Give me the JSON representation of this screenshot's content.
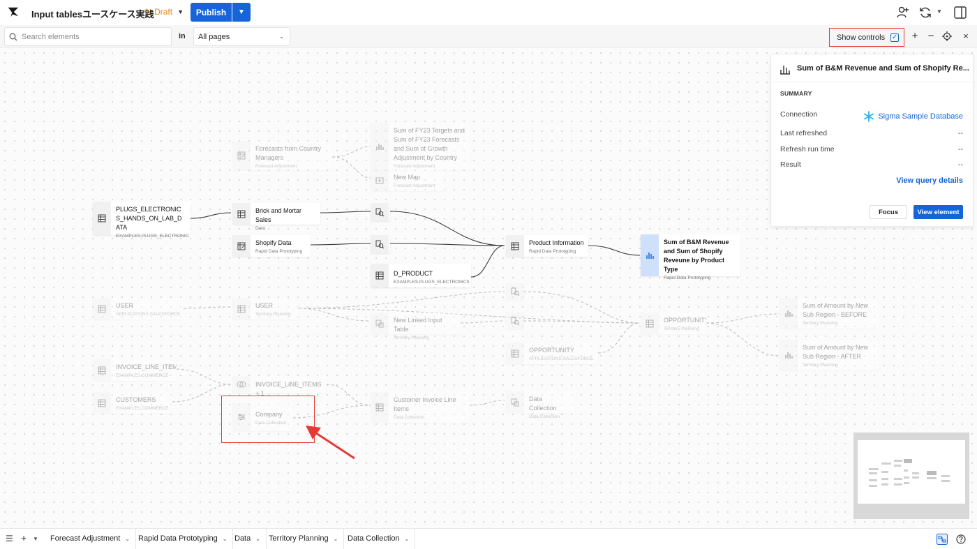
{
  "header": {
    "title": "Input tablesユースケース実践",
    "status": "Draft",
    "publish_label": "Publish"
  },
  "filter_bar": {
    "search_placeholder": "Search elements",
    "in_label": "in",
    "pages_value": "All pages",
    "show_controls_label": "Show controls",
    "show_controls_checked": true
  },
  "nodes": [
    {
      "id": "n1",
      "name": "Forecasts from Country Managers",
      "sub": "Forecast Adjustment",
      "icon": "input-table-icon",
      "faded": true
    },
    {
      "id": "n2",
      "name": "Sum of FY23 Targets and Sum of FY23 Forecasts and Sum of Growth Adjustment by Country",
      "sub": "Forecast Adjustment",
      "icon": "bar-chart-icon",
      "faded": true
    },
    {
      "id": "n3",
      "name": "New Map",
      "sub": "Forecast Adjustment",
      "icon": "map-icon",
      "faded": true
    },
    {
      "id": "n4",
      "name": "PLUGS_ELECTRONICS_HANDS_ON_LAB_DATA",
      "sub": "EXAMPLES.PLUGS_ELECTRONICS",
      "icon": "table-icon",
      "faded": false
    },
    {
      "id": "n5",
      "name": "Brick and Mortar Sales",
      "sub": "Data",
      "icon": "table-icon",
      "faded": false
    },
    {
      "id": "n6",
      "name": "Shopify Data",
      "sub": "Rapid Data Prototyping",
      "icon": "input-table-icon",
      "faded": false
    },
    {
      "id": "n7",
      "name": "D_PRODUCT",
      "sub": "EXAMPLES.PLUGS_ELECTRONICS",
      "icon": "table-icon",
      "faded": false
    },
    {
      "id": "n8",
      "name": "Product Information",
      "sub": "Rapid Data Prototyping",
      "icon": "table-icon",
      "faded": false
    },
    {
      "id": "n9",
      "name": "Sum of B&M Revenue and Sum of Shopify Reveune by Product Type",
      "sub": "Rapid Data Prototyping",
      "icon": "bar-chart-icon",
      "faded": false,
      "selected": true
    },
    {
      "id": "n10",
      "name": "USER",
      "sub": "APPLICATIONS.SALESFORCE",
      "icon": "table-icon",
      "faded": true
    },
    {
      "id": "n11",
      "name": "USER",
      "sub": "Territory Planning",
      "icon": "table-icon",
      "faded": true
    },
    {
      "id": "n12",
      "name": "New Linked Input Table",
      "sub": "Territory Planning",
      "icon": "linked-table-icon",
      "faded": true
    },
    {
      "id": "n13",
      "name": "OPPORTUNITY",
      "sub": "Territory Planning",
      "icon": "table-icon",
      "faded": true
    },
    {
      "id": "n14",
      "name": "OPPORTUNITY",
      "sub": "APPLICATIONS.SALESFORCE",
      "icon": "table-icon",
      "faded": true
    },
    {
      "id": "n15",
      "name": "Sum of Amount by New Sub Region - BEFORE",
      "sub": "Territory Planning",
      "icon": "bar-chart-icon",
      "faded": true
    },
    {
      "id": "n16",
      "name": "Sum of Amount by New Sub Region - AFTER",
      "sub": "Territory Planning",
      "icon": "bar-chart-icon",
      "faded": true
    },
    {
      "id": "n17",
      "name": "INVOICE_LINE_ITEMS",
      "sub": "EXAMPLES.COMMERCE",
      "icon": "table-icon",
      "faded": true
    },
    {
      "id": "n18",
      "name": "CUSTOMERS",
      "sub": "EXAMPLES.COMMERCE",
      "icon": "table-icon",
      "faded": true
    },
    {
      "id": "n19",
      "name": "INVOICE_LINE_ITEMS + 1",
      "sub": "",
      "icon": "join-icon",
      "faded": true
    },
    {
      "id": "n20",
      "name": "Company",
      "sub": "Data Collection",
      "icon": "control-icon",
      "faded": true
    },
    {
      "id": "n21",
      "name": "Customer Invoice Line Items",
      "sub": "Data Collection",
      "icon": "table-icon",
      "faded": true
    },
    {
      "id": "n22",
      "name": "Data Collection",
      "sub": "Data Collection",
      "icon": "linked-table-icon",
      "faded": true
    }
  ],
  "panel": {
    "title": "Sum of B&M Revenue and Sum of Shopify Re...",
    "summary_heading": "SUMMARY",
    "rows": [
      {
        "key": "Connection",
        "value": "Sigma Sample Database"
      },
      {
        "key": "Last refreshed",
        "value": "--"
      },
      {
        "key": "Refresh run time",
        "value": "--"
      },
      {
        "key": "Result",
        "value": "--"
      }
    ],
    "view_query_label": "View query details",
    "focus_label": "Focus",
    "view_element_label": "View element"
  },
  "bottom_tabs": [
    "Forecast Adjustment",
    "Rapid Data Prototyping",
    "Data",
    "Territory Planning",
    "Data Collection"
  ],
  "colors": {
    "accent": "#1565d8",
    "draft": "#e08a1e",
    "highlight": "#e53935",
    "selected": "#cfe0fb"
  }
}
